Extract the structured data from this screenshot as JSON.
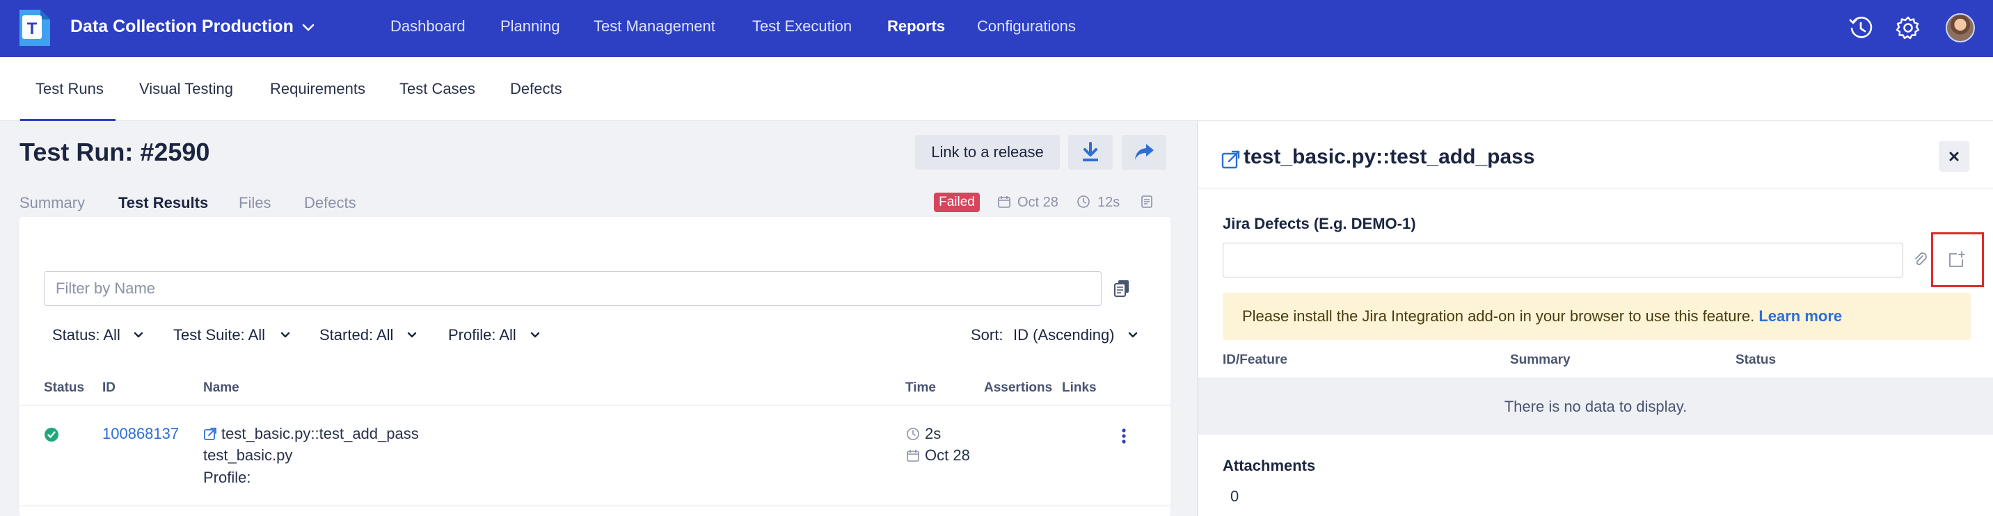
{
  "colors": {
    "brand": "#2d40c4",
    "failed": "#d6455c",
    "passed": "#1fa97a",
    "link": "#2d6fd6",
    "highlight": "#e02b2b"
  },
  "topbar": {
    "project": "Data Collection Production",
    "nav": [
      "Dashboard",
      "Planning",
      "Test Management",
      "Test Execution",
      "Reports",
      "Configurations"
    ],
    "active_nav": "Reports",
    "icons": [
      "history-icon",
      "gear-icon",
      "avatar"
    ]
  },
  "subnav": {
    "tabs": [
      "Test Runs",
      "Visual Testing",
      "Requirements",
      "Test Cases",
      "Defects"
    ],
    "active": "Test Runs"
  },
  "run": {
    "title": "Test Run: #2590",
    "link_release_label": "Link to a release",
    "tabs": [
      "Summary",
      "Test Results",
      "Files",
      "Defects"
    ],
    "active_tab": "Test Results",
    "status": "Failed",
    "date": "Oct 28",
    "duration": "12s"
  },
  "results": {
    "filter_placeholder": "Filter by Name",
    "filters": [
      "Status: All",
      "Test Suite: All",
      "Started: All",
      "Profile: All"
    ],
    "sort_label": "Sort:",
    "sort_value": "ID (Ascending)",
    "columns": [
      "Status",
      "ID",
      "Name",
      "Time",
      "Assertions",
      "Links"
    ],
    "rows": [
      {
        "status": "passed",
        "id": "100868137",
        "name": "test_basic.py::test_add_pass",
        "suite": "test_basic.py",
        "profile": "Profile:",
        "time": "2s",
        "date": "Oct 28"
      }
    ]
  },
  "detail": {
    "title": "test_basic.py::test_add_pass",
    "jira_label": "Jira Defects (E.g. DEMO-1)",
    "jira_value": "",
    "warning": "Please install the Jira Integration add-on in your browser to use this feature.",
    "learn_more": "Learn more",
    "columns": [
      "ID/Feature",
      "Summary",
      "Status"
    ],
    "empty": "There is no data to display.",
    "attachments_label": "Attachments",
    "attachments_count": "0"
  }
}
